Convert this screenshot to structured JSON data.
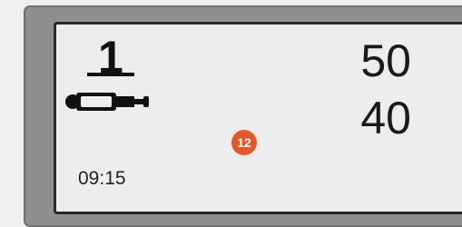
{
  "display": {
    "channel_number": "1",
    "channel_icon": "hydraulic-cylinder-icon",
    "value_top": "50",
    "value_bottom": "40",
    "badge_count": "12",
    "clock_time": "09:15"
  },
  "colors": {
    "frame": "#8f8f8f",
    "screen_background": "#ededed",
    "badge": "#e4572b",
    "text": "#111111"
  }
}
